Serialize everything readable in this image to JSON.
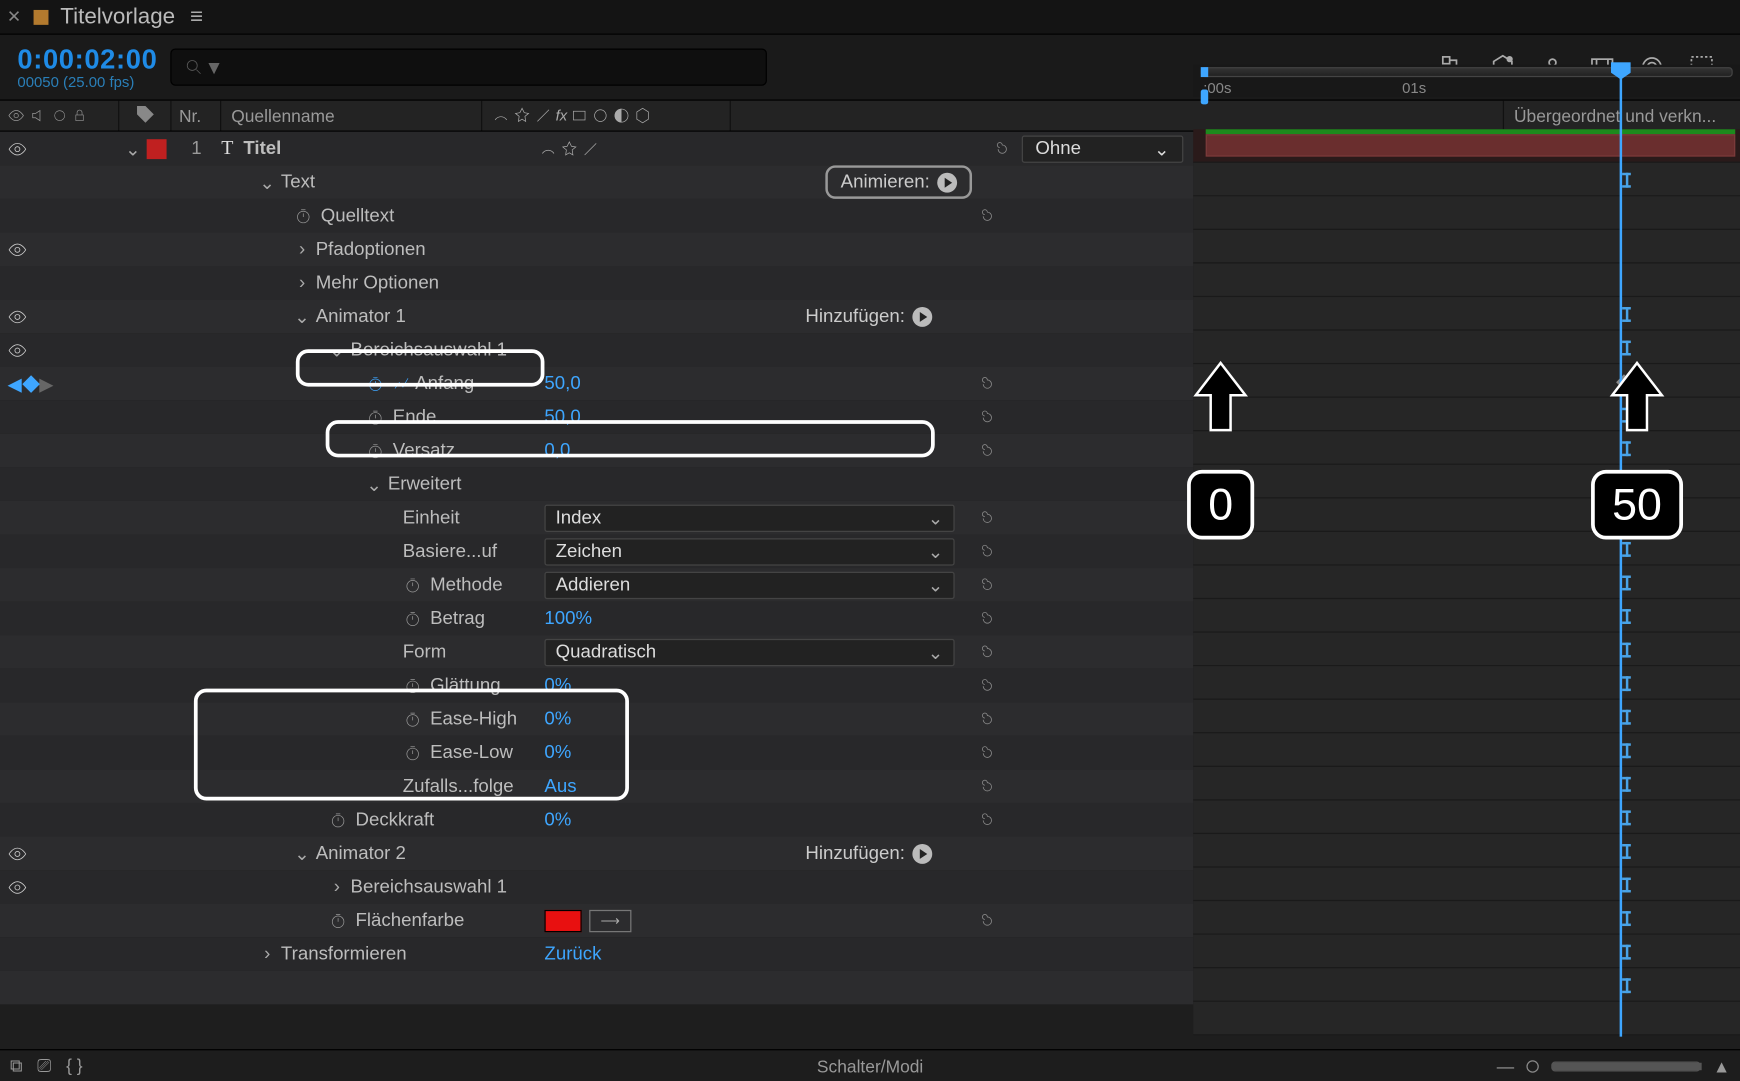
{
  "tab": {
    "title": "Titelvorlage"
  },
  "timecode": {
    "value": "0:00:02:00",
    "frames": "00050 (25.00 fps)"
  },
  "columns": {
    "nr": "Nr.",
    "source": "Quellenname",
    "parent": "Übergeordnet und verkn..."
  },
  "layer1": {
    "index": "1",
    "name": "Titel",
    "parent": "Ohne"
  },
  "groups": {
    "text": "Text",
    "quelltext": "Quelltext",
    "pfad": "Pfadoptionen",
    "mehr": "Mehr Optionen",
    "animator1": "Animator 1",
    "range1": "Bereichsauswahl 1",
    "erweitert": "Erweitert",
    "animator2": "Animator 2",
    "range2": "Bereichsauswahl 1",
    "transform": "Transformieren"
  },
  "anim": {
    "animate": "Animieren:",
    "add1": "Hinzufügen:",
    "add2": "Hinzufügen:"
  },
  "props": {
    "anfang": {
      "label": "Anfang",
      "value": "50,0"
    },
    "ende": {
      "label": "Ende",
      "value": "50,0"
    },
    "versatz": {
      "label": "Versatz",
      "value": "0,0"
    },
    "einheit": {
      "label": "Einheit",
      "value": "Index"
    },
    "basiere": {
      "label": "Basiere...uf",
      "value": "Zeichen"
    },
    "methode": {
      "label": "Methode",
      "value": "Addieren"
    },
    "betrag": {
      "label": "Betrag",
      "value": "100%"
    },
    "form": {
      "label": "Form",
      "value": "Quadratisch"
    },
    "glaettung": {
      "label": "Glättung",
      "value": "0%"
    },
    "easehigh": {
      "label": "Ease-High",
      "value": "0%"
    },
    "easelow": {
      "label": "Ease-Low",
      "value": "0%"
    },
    "zufall": {
      "label": "Zufalls...folge",
      "value": "Aus"
    },
    "deckkraft": {
      "label": "Deckkraft",
      "value": "0%"
    },
    "fillcolor": {
      "label": "Flächenfarbe"
    },
    "transform_reset": "Zurück"
  },
  "ruler": {
    "t0": ":00s",
    "t1": "01s"
  },
  "footer": {
    "mode": "Schalter/Modi"
  },
  "anno": {
    "left": "0",
    "right": "50"
  }
}
